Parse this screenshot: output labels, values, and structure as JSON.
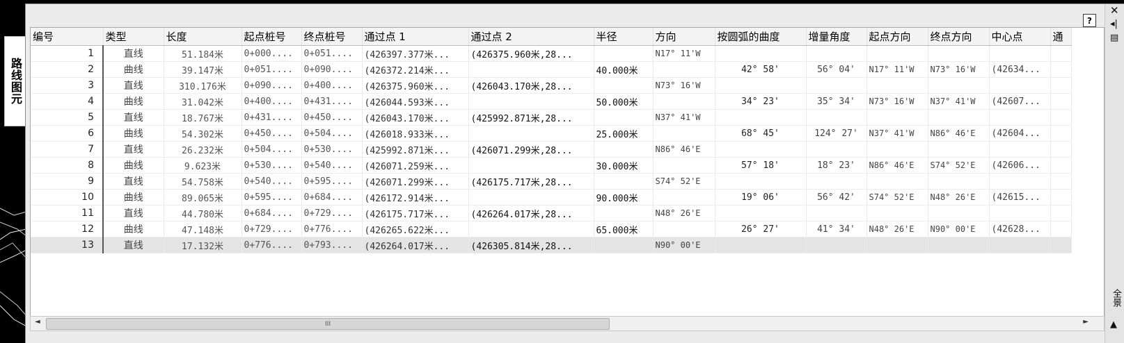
{
  "side_tab": {
    "label": "路线图元"
  },
  "window": {
    "title": "全景",
    "help_label": "?"
  },
  "icons": {
    "close": "close-icon",
    "autohide": "autohide-icon",
    "properties": "properties-icon",
    "menu": "menu-icon"
  },
  "columns": [
    "编号",
    "类型",
    "长度",
    "起点桩号",
    "终点桩号",
    "通过点 1",
    "通过点 2",
    "半径",
    "方向",
    "按圆弧的曲度",
    "增量角度",
    "起点方向",
    "终点方向",
    "中心点",
    "通"
  ],
  "rows": [
    [
      "1",
      "直线",
      "51.184米",
      "0+000....",
      "0+051....",
      "(426397.377米...",
      "(426375.960米,28...",
      "",
      "N17° 11'W",
      "",
      "",
      "",
      "",
      ""
    ],
    [
      "2",
      "曲线",
      "39.147米",
      "0+051....",
      "0+090....",
      "(426372.214米...",
      "",
      "40.000米",
      "",
      "42° 58'",
      "56° 04'",
      "N17° 11'W",
      "N73° 16'W",
      "(42634..."
    ],
    [
      "3",
      "直线",
      "310.176米",
      "0+090....",
      "0+400....",
      "(426375.960米...",
      "(426043.170米,28...",
      "",
      "N73° 16'W",
      "",
      "",
      "",
      "",
      ""
    ],
    [
      "4",
      "曲线",
      "31.042米",
      "0+400....",
      "0+431....",
      "(426044.593米...",
      "",
      "50.000米",
      "",
      "34° 23'",
      "35° 34'",
      "N73° 16'W",
      "N37° 41'W",
      "(42607..."
    ],
    [
      "5",
      "直线",
      "18.767米",
      "0+431....",
      "0+450....",
      "(426043.170米...",
      "(425992.871米,28...",
      "",
      "N37° 41'W",
      "",
      "",
      "",
      "",
      ""
    ],
    [
      "6",
      "曲线",
      "54.302米",
      "0+450....",
      "0+504....",
      "(426018.933米...",
      "",
      "25.000米",
      "",
      "68° 45'",
      "124° 27'",
      "N37° 41'W",
      "N86° 46'E",
      "(42604..."
    ],
    [
      "7",
      "直线",
      "26.232米",
      "0+504....",
      "0+530....",
      "(425992.871米...",
      "(426071.299米,28...",
      "",
      "N86° 46'E",
      "",
      "",
      "",
      "",
      ""
    ],
    [
      "8",
      "曲线",
      "9.623米",
      "0+530....",
      "0+540....",
      "(426071.259米...",
      "",
      "30.000米",
      "",
      "57° 18'",
      "18° 23'",
      "N86° 46'E",
      "S74° 52'E",
      "(42606..."
    ],
    [
      "9",
      "直线",
      "54.758米",
      "0+540....",
      "0+595....",
      "(426071.299米...",
      "(426175.717米,28...",
      "",
      "S74° 52'E",
      "",
      "",
      "",
      "",
      ""
    ],
    [
      "10",
      "曲线",
      "89.065米",
      "0+595....",
      "0+684....",
      "(426172.914米...",
      "",
      "90.000米",
      "",
      "19° 06'",
      "56° 42'",
      "S74° 52'E",
      "N48° 26'E",
      "(42615..."
    ],
    [
      "11",
      "直线",
      "44.780米",
      "0+684....",
      "0+729....",
      "(426175.717米...",
      "(426264.017米,28...",
      "",
      "N48° 26'E",
      "",
      "",
      "",
      "",
      ""
    ],
    [
      "12",
      "曲线",
      "47.148米",
      "0+729....",
      "0+776....",
      "(426265.622米...",
      "",
      "65.000米",
      "",
      "26° 27'",
      "41° 34'",
      "N48° 26'E",
      "N90° 00'E",
      "(42628..."
    ],
    [
      "13",
      "直线",
      "17.132米",
      "0+776....",
      "0+793....",
      "(426264.017米...",
      "(426305.814米,28...",
      "",
      "N90° 00'E",
      "",
      "",
      "",
      "",
      ""
    ]
  ],
  "selected_row": 13,
  "scrollbar": {
    "thumb_glyph": "III",
    "left_arrow": "◄",
    "right_arrow": "►"
  }
}
